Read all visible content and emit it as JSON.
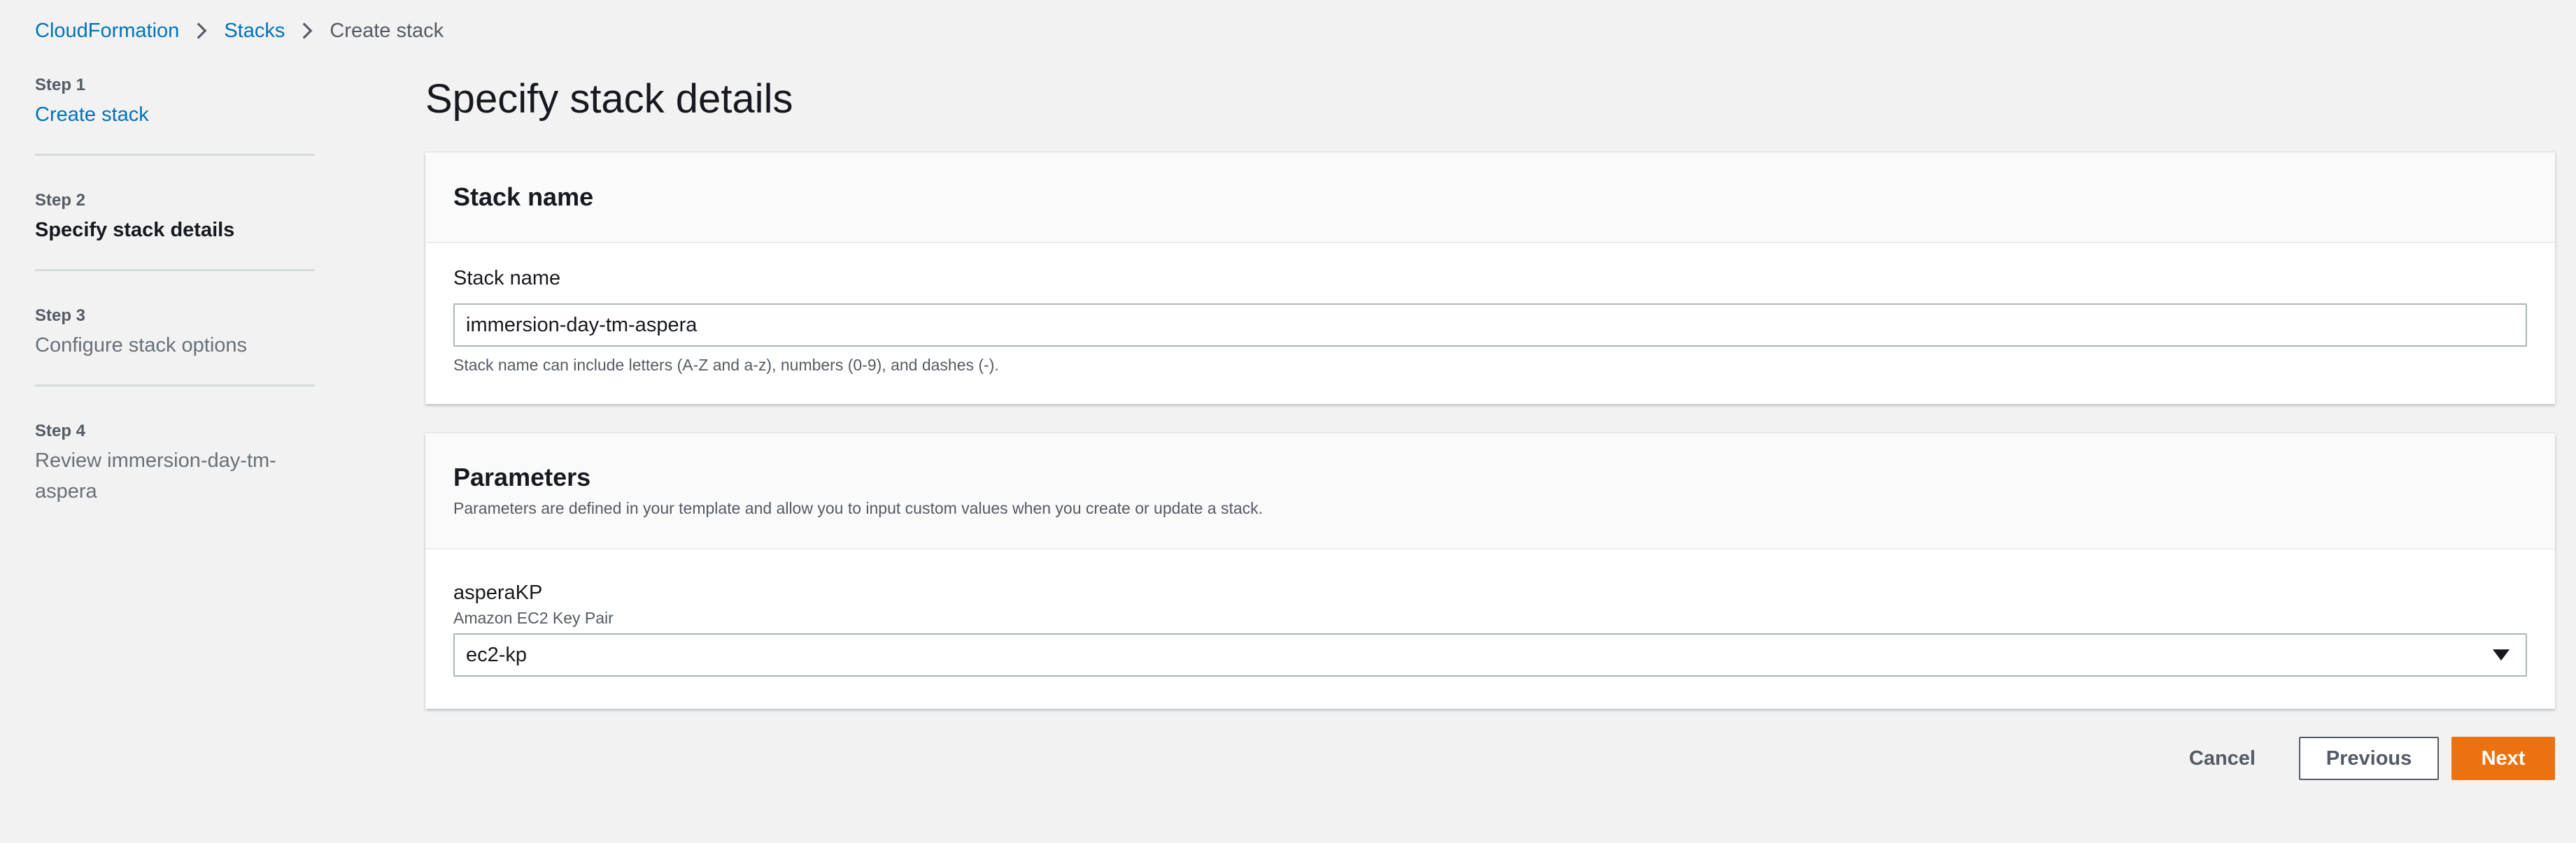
{
  "breadcrumb": {
    "items": [
      "CloudFormation",
      "Stacks"
    ],
    "current": "Create stack"
  },
  "steps": [
    {
      "number": "Step 1",
      "title": "Create stack",
      "state": "link"
    },
    {
      "number": "Step 2",
      "title": "Specify stack details",
      "state": "current"
    },
    {
      "number": "Step 3",
      "title": "Configure stack options",
      "state": "disabled"
    },
    {
      "number": "Step 4",
      "title": "Review immersion-day-tm-aspera",
      "state": "disabled"
    }
  ],
  "page": {
    "title": "Specify stack details"
  },
  "stack_name_panel": {
    "heading": "Stack name",
    "field_label": "Stack name",
    "value": "immersion-day-tm-aspera",
    "hint": "Stack name can include letters (A-Z and a-z), numbers (0-9), and dashes (-)."
  },
  "parameters_panel": {
    "heading": "Parameters",
    "description": "Parameters are defined in your template and allow you to input custom values when you create or update a stack.",
    "params": [
      {
        "name": "asperaKP",
        "description": "Amazon EC2 Key Pair",
        "selected": "ec2-kp"
      }
    ]
  },
  "actions": {
    "cancel": "Cancel",
    "previous": "Previous",
    "next": "Next"
  },
  "colors": {
    "link": "#0073bb",
    "primary": "#ec7211",
    "background": "#f2f2f2"
  },
  "icons": {
    "breadcrumb_separator": "chevron-right-icon",
    "select": "caret-down-icon"
  }
}
